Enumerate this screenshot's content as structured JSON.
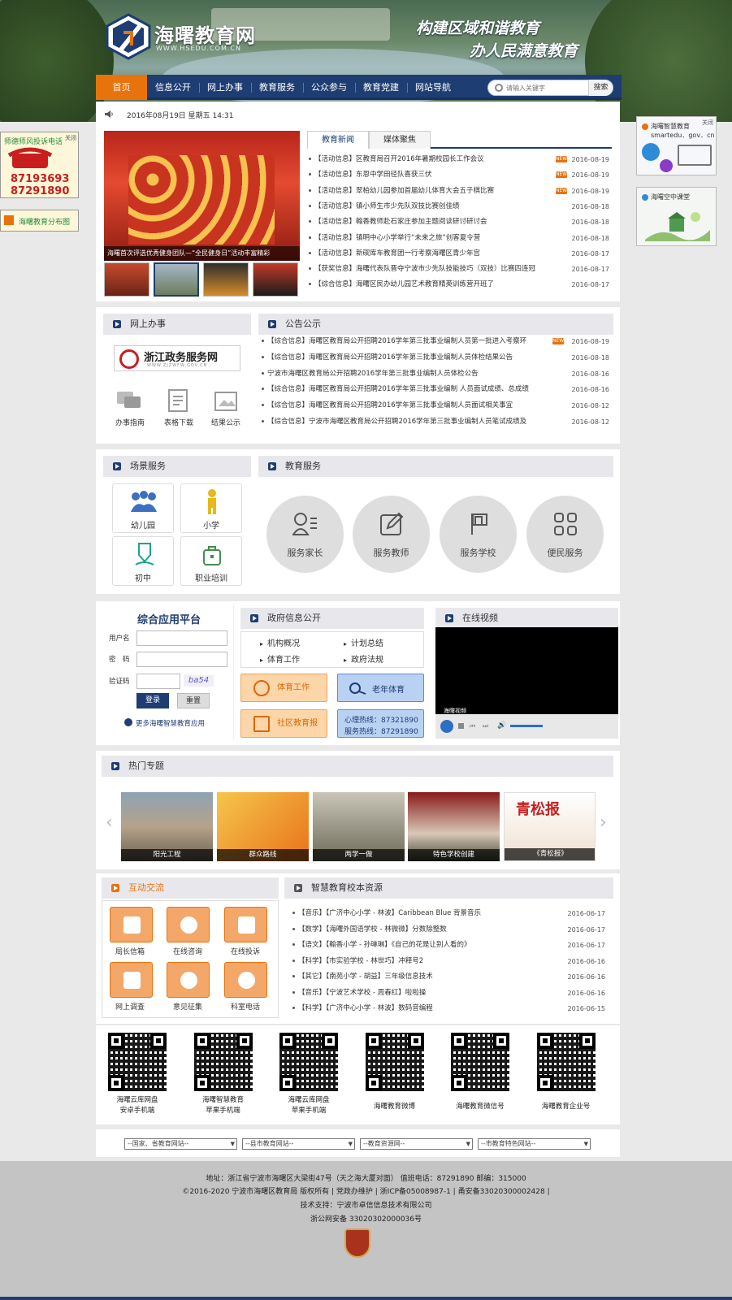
{
  "header": {
    "logo_text": "海曙教育网",
    "logo_url": "WWW.HSEDU.COM.CN",
    "slogan_line1": "构建区域和谐教育",
    "slogan_line2": "办人民满意教育"
  },
  "nav": {
    "items": [
      "首页",
      "信息公开",
      "网上办事",
      "教育服务",
      "公众参与",
      "教育党建",
      "网站导航"
    ],
    "search_placeholder": "请输入关键字",
    "search_button": "搜索"
  },
  "date_text": "2016年08月19日 星期五 14:31",
  "slideshow": {
    "caption": "海曙首次评选优秀健身团队—“全民健身日”活动丰富精彩"
  },
  "news": {
    "tabs": [
      "教育新闻",
      "媒体聚焦"
    ],
    "items": [
      {
        "title": "【活动信息】区教育局召开2016年暑期校园长工作会议",
        "date": "2016-08-19",
        "new": true
      },
      {
        "title": "【活动信息】东恩中学田径队喜获三伏",
        "date": "2016-08-19",
        "new": true
      },
      {
        "title": "【活动信息】翠柏幼儿园参加首届幼儿体育大会五子棋比赛",
        "date": "2016-08-19",
        "new": true
      },
      {
        "title": "【活动信息】镇小师生市少先队双技比赛创佳绩",
        "date": "2016-08-18",
        "new": false
      },
      {
        "title": "【活动信息】翰香教师赴石家庄参加主题阅读研讨研讨会",
        "date": "2016-08-18",
        "new": false
      },
      {
        "title": "【活动信息】镇明中心小学举行“未来之旅”创客夏令营",
        "date": "2016-08-18",
        "new": false
      },
      {
        "title": "【活动信息】新碶库车教育团一行考察海曙区青少年宫",
        "date": "2016-08-17",
        "new": false
      },
      {
        "title": "【获奖信息】海曙代表队晋夺宁波市少先队技能技巧（双技）比赛四连冠",
        "date": "2016-08-17",
        "new": false
      },
      {
        "title": "【综合信息】海曙区民办幼儿园艺术教育精英训练营开班了",
        "date": "2016-08-17",
        "new": false
      }
    ]
  },
  "online_service": {
    "title": "网上办事",
    "zj_title": "浙江政务服务网",
    "zj_sub": "WWW.ZJZWFW.GOV.CN",
    "icons": [
      "办事指南",
      "表格下载",
      "结果公示"
    ]
  },
  "notices": {
    "title": "公告公示",
    "items": [
      {
        "title": "【综合信息】海曙区教育局公开招聘2016学年第三批事业编制人员第一批进入考察环",
        "date": "2016-08-19",
        "new": true
      },
      {
        "title": "【综合信息】海曙区教育局公开招聘2016学年第三批事业编制人员体检结果公告",
        "date": "2016-08-18",
        "new": false
      },
      {
        "title": "宁波市海曙区教育局公开招聘2016学年第三批事业编制人员体检公告",
        "date": "2016-08-16",
        "new": false
      },
      {
        "title": "【综合信息】海曙区教育局公开招聘2016学年第三批事业编制 人员面试成绩、总成绩",
        "date": "2016-08-16",
        "new": false
      },
      {
        "title": "【综合信息】海曙区教育局公开招聘2016学年第三批事业编制人员面试相关事宜",
        "date": "2016-08-12",
        "new": false
      },
      {
        "title": "【综合信息】宁波市海曙区教育局公开招聘2016学年第三批事业编制人员笔试成绩及",
        "date": "2016-08-12",
        "new": false
      }
    ]
  },
  "scene_service": {
    "title": "场景服务",
    "items": [
      "幼儿园",
      "小学",
      "初中",
      "职业培训"
    ]
  },
  "edu_service": {
    "title": "教育服务",
    "items": [
      "服务家长",
      "服务教师",
      "服务学校",
      "便民服务"
    ]
  },
  "login": {
    "title": "综合应用平台",
    "username_label": "用户名",
    "password_label": "密　码",
    "captcha_label": "验证码",
    "captcha_text": "ba54",
    "login_button": "登录",
    "reset_button": "重置",
    "more_link": "更多海曙智慧教育应用"
  },
  "gov_info": {
    "title": "政府信息公开",
    "links": [
      "机构概况",
      "计划总结",
      "体育工作",
      "政府法规"
    ],
    "buttons": [
      "体育工作",
      "老年体育",
      "社区教育报"
    ],
    "hotline1": "心理热线：87321890",
    "hotline2": "服务热线：87291890"
  },
  "video": {
    "title": "在线视频",
    "label": "海曙视频"
  },
  "topics": {
    "title": "热门专题",
    "items": [
      "阳光工程",
      "群众路线",
      "两学一做",
      "特色学校创建",
      "《青松报》"
    ]
  },
  "interaction": {
    "title": "互动交流",
    "items": [
      "局长信箱",
      "在线咨询",
      "在线投诉",
      "网上调查",
      "意见征集",
      "科室电话"
    ]
  },
  "resources": {
    "title": "智慧教育校本资源",
    "items": [
      {
        "title": "【音乐】【广济中心小学 - 林波】Caribbean Blue 背景音乐",
        "date": "2016-06-17"
      },
      {
        "title": "【数学】【海曙外国语学校 - 林微微】分数除整数",
        "date": "2016-06-17"
      },
      {
        "title": "【语文】【翰香小学 - 孙琳琳】《自己的花是让别人看的》",
        "date": "2016-06-17"
      },
      {
        "title": "【科学】【市实验学校 - 林世巧】冲释号2",
        "date": "2016-06-16"
      },
      {
        "title": "【其它】【南苑小学 - 胡益】三年级信息技术",
        "date": "2016-06-16"
      },
      {
        "title": "【音乐】【宁波艺术学校 - 周春红】啦啦操",
        "date": "2016-06-16"
      },
      {
        "title": "【科学】【广济中心小学 - 林波】数码音编程",
        "date": "2016-06-15"
      }
    ]
  },
  "qr_codes": [
    {
      "line1": "海曙云库网盘",
      "line2": "安卓手机端"
    },
    {
      "line1": "海曙智慧教育",
      "line2": "苹果手机端"
    },
    {
      "line1": "海曙云库网盘",
      "line2": "苹果手机端"
    },
    {
      "line1": "海曙教育微博",
      "line2": ""
    },
    {
      "line1": "海曙教育微信号",
      "line2": ""
    },
    {
      "line1": "海曙教育企业号",
      "line2": ""
    }
  ],
  "selects": [
    "--国家、省教育网站--",
    "--县市教育网站--",
    "--教育资源网--",
    "--市教育特色网站--"
  ],
  "footer": {
    "line1": "地址：浙江省宁波市海曙区大梁街47号（天之海大厦对面） 值班电话：87291890 邮编：315000",
    "line2": "©2016-2020 宁波市海曙区教育局 版权所有 | 党政办维护 | 浙ICP备05008987-1 | 甬安备33020300002428 |",
    "line3": "技术支持：宁波市卓信信息技术有限公司",
    "line4": "浙公网安备 33020302000036号"
  },
  "floats": {
    "left_title": "师德师风投诉电话",
    "left_close": "关闭",
    "left_phone1": "87193693",
    "left_phone2": "87291890",
    "left2_title": "海曙教育分布图",
    "right_title": "海曙智慧教育",
    "right_url": "smartedu．gov．cn",
    "right_close": "关闭",
    "right2_title": "海曙空中课堂"
  }
}
